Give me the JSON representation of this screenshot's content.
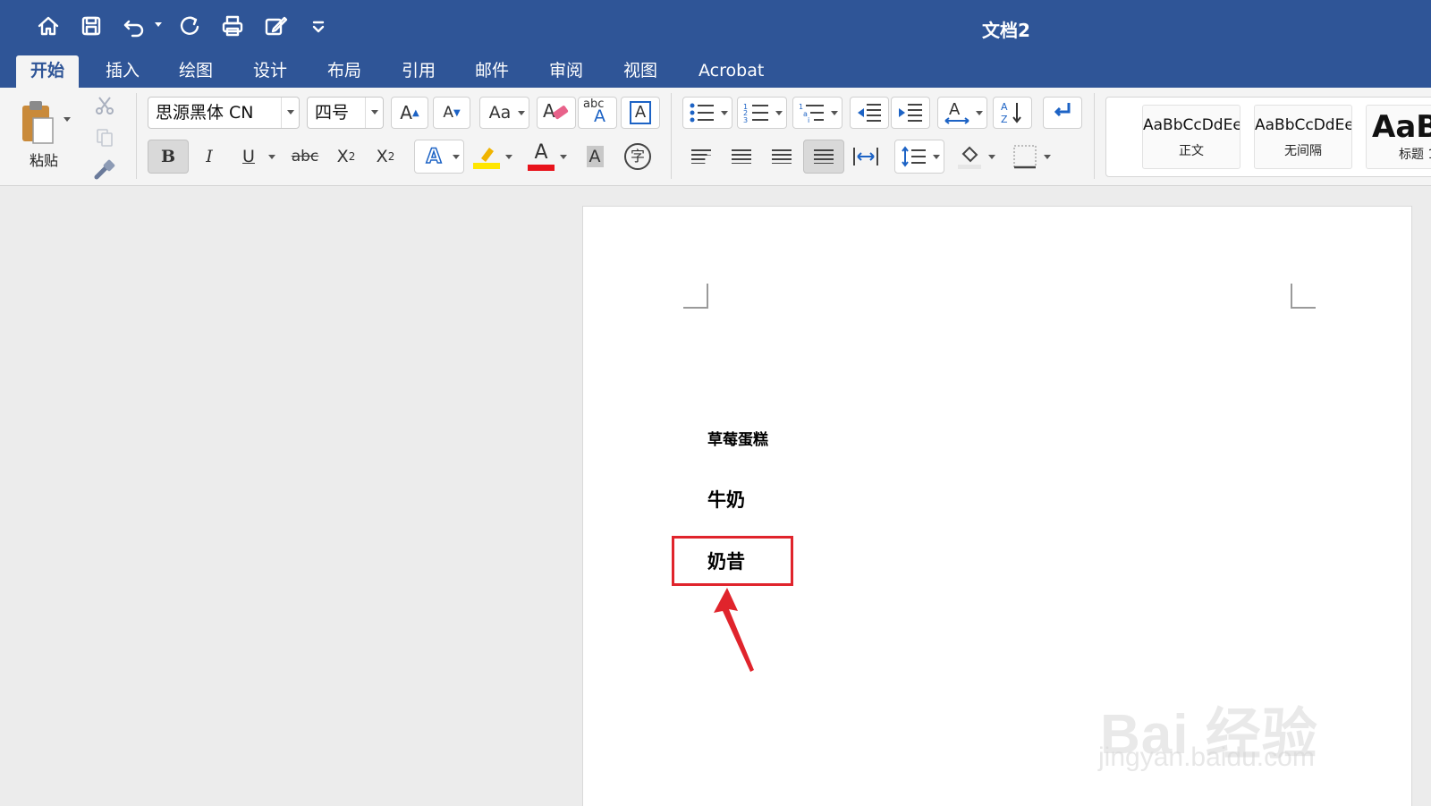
{
  "title_bar": {
    "document_title": "文档2",
    "quick_access_icons": [
      "home-icon",
      "save-icon",
      "undo-icon",
      "redo-icon",
      "print-icon",
      "edit-icon",
      "customize-icon"
    ]
  },
  "ribbon_tabs": [
    "开始",
    "插入",
    "绘图",
    "设计",
    "布局",
    "引用",
    "邮件",
    "审阅",
    "视图",
    "Acrobat"
  ],
  "active_tab": "开始",
  "clipboard": {
    "paste_label": "粘贴"
  },
  "font": {
    "font_name": "思源黑体 CN",
    "font_size": "四号",
    "bold": "B",
    "italic": "I",
    "underline": "U",
    "strikethrough": "abc",
    "subscript": "X",
    "subscript_mark": "2",
    "superscript": "X",
    "superscript_mark": "2",
    "grow_font": "A",
    "shrink_font": "A",
    "change_case": "Aa",
    "phonetic": "abc",
    "char_border": "A",
    "text_effects": "A",
    "font_color_letter": "A",
    "char_shading": "A",
    "enclose_char": "字",
    "highlight_color": "#ffe600",
    "font_color": "#e8131b"
  },
  "styles": [
    {
      "preview": "AaBbCcDdEe",
      "name": "正文"
    },
    {
      "preview": "AaBbCcDdEe",
      "name": "无间隔"
    },
    {
      "preview": "AaB",
      "name": "标题 1"
    }
  ],
  "document": {
    "lines": [
      "草莓蛋糕",
      "牛奶",
      "奶昔"
    ],
    "highlighted_line": "奶昔",
    "annotation_color": "#e0242c"
  },
  "watermark": {
    "brand": "Bai 经验",
    "url": "jingyan.baidu.com"
  }
}
